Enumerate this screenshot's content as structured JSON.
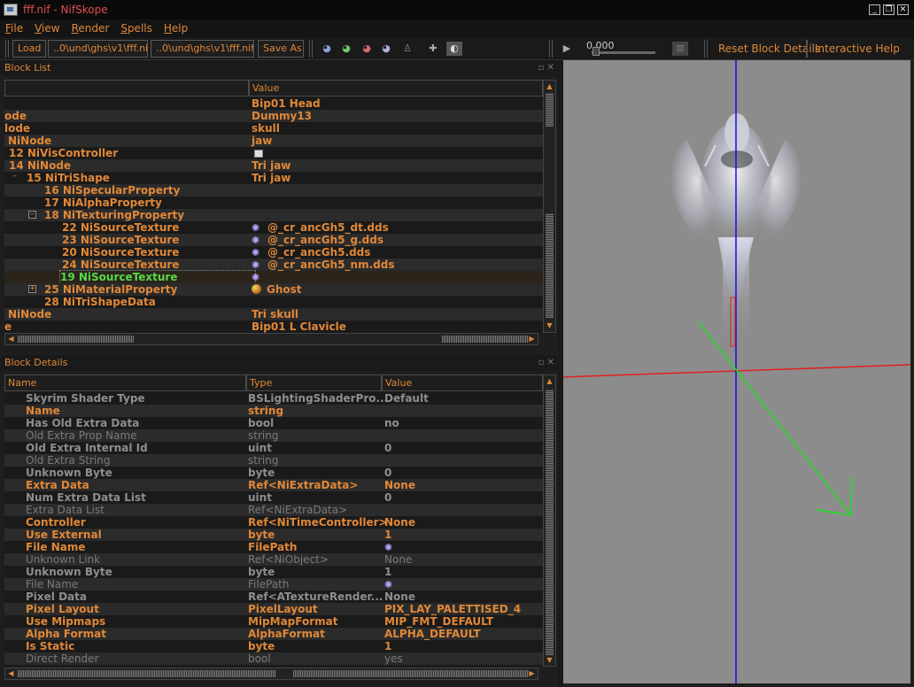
{
  "window": {
    "title": "fff.nif - NifSkope",
    "controls": [
      "_",
      "❐",
      "✕"
    ]
  },
  "menu": [
    "File",
    "View",
    "Render",
    "Spells",
    "Help"
  ],
  "toolbar": {
    "load_label": "Load",
    "load_path": "..0\\und\\ghs\\v1\\fff.nif",
    "save_path": "..0\\und\\ghs\\v1\\fff.nif",
    "save_as_label": "Save As",
    "time_value": "0.000",
    "reset_label": "Reset Block Details",
    "help_label": "Interactive Help",
    "view_icons": [
      "eye-icon",
      "eye-icon",
      "eye-icon",
      "eye-icon",
      "figure-icon",
      "axes-icon",
      "shading-icon"
    ]
  },
  "block_list": {
    "title": "Block List",
    "header_value": "Value",
    "rows": [
      {
        "name": "",
        "value": "Bip01 Head"
      },
      {
        "name": "ode",
        "value": "Dummy13"
      },
      {
        "name": "lode",
        "value": "skull"
      },
      {
        "name": "NiNode",
        "value": "jaw"
      },
      {
        "name": "12 NiVisController",
        "value": ""
      },
      {
        "name": "14 NiNode",
        "value": "Tri jaw"
      },
      {
        "name": "15 NiTriShape",
        "value": "Tri jaw"
      },
      {
        "name": "16 NiSpecularProperty",
        "value": ""
      },
      {
        "name": "17 NiAlphaProperty",
        "value": ""
      },
      {
        "name": "18 NiTexturingProperty",
        "value": ""
      },
      {
        "name": "22 NiSourceTexture",
        "value": "@_cr_ancGh5_dt.dds"
      },
      {
        "name": "23 NiSourceTexture",
        "value": "@_cr_ancGh5_g.dds"
      },
      {
        "name": "20 NiSourceTexture",
        "value": "@_cr_ancGh5.dds"
      },
      {
        "name": "24 NiSourceTexture",
        "value": "@_cr_ancGh5_nm.dds"
      },
      {
        "name": "19 NiSourceTexture",
        "value": ""
      },
      {
        "name": "25 NiMaterialProperty",
        "value": "Ghost"
      },
      {
        "name": "28 NiTriShapeData",
        "value": ""
      },
      {
        "name": "NiNode",
        "value": "Tri skull"
      },
      {
        "name": "e",
        "value": "Bip01 L Clavicle"
      }
    ]
  },
  "block_details": {
    "title": "Block Details",
    "headers": {
      "name": "Name",
      "type": "Type",
      "value": "Value"
    },
    "rows": [
      {
        "name": "Skyrim Shader Type",
        "type": "BSLightingShaderPro...",
        "value": "Default"
      },
      {
        "name": "Name",
        "type": "string",
        "value": ""
      },
      {
        "name": "Has Old Extra Data",
        "type": "bool",
        "value": "no"
      },
      {
        "name": "Old Extra Prop Name",
        "type": "string",
        "value": ""
      },
      {
        "name": "Old Extra Internal Id",
        "type": "uint",
        "value": "0"
      },
      {
        "name": "Old Extra String",
        "type": "string",
        "value": ""
      },
      {
        "name": "Unknown Byte",
        "type": "byte",
        "value": "0"
      },
      {
        "name": "Extra Data",
        "type": "Ref<NiExtraData>",
        "value": "None"
      },
      {
        "name": "Num Extra Data List",
        "type": "uint",
        "value": "0"
      },
      {
        "name": "Extra Data List",
        "type": "Ref<NiExtraData>",
        "value": ""
      },
      {
        "name": "Controller",
        "type": "Ref<NiTimeController>",
        "value": "None"
      },
      {
        "name": "Use External",
        "type": "byte",
        "value": "1"
      },
      {
        "name": "File Name",
        "type": "FilePath",
        "value": ""
      },
      {
        "name": "Unknown Link",
        "type": "Ref<NiObject>",
        "value": "None"
      },
      {
        "name": "Unknown Byte",
        "type": "byte",
        "value": "1"
      },
      {
        "name": "File Name",
        "type": "FilePath",
        "value": ""
      },
      {
        "name": "Pixel Data",
        "type": "Ref<ATextureRender...",
        "value": "None"
      },
      {
        "name": "Pixel Layout",
        "type": "PixelLayout",
        "value": "PIX_LAY_PALETTISED_4"
      },
      {
        "name": "Use Mipmaps",
        "type": "MipMapFormat",
        "value": "MIP_FMT_DEFAULT"
      },
      {
        "name": "Alpha Format",
        "type": "AlphaFormat",
        "value": "ALPHA_DEFAULT"
      },
      {
        "name": "Is Static",
        "type": "byte",
        "value": "1"
      },
      {
        "name": "Direct Render",
        "type": "bool",
        "value": "yes"
      }
    ]
  },
  "colors": {
    "accent": "#e08838",
    "selected": "#5ad84a",
    "viewport_bg": "#8c8c8c",
    "axis_x": "#e02020",
    "axis_y": "#1010e0",
    "axis_z": "#20e020"
  }
}
